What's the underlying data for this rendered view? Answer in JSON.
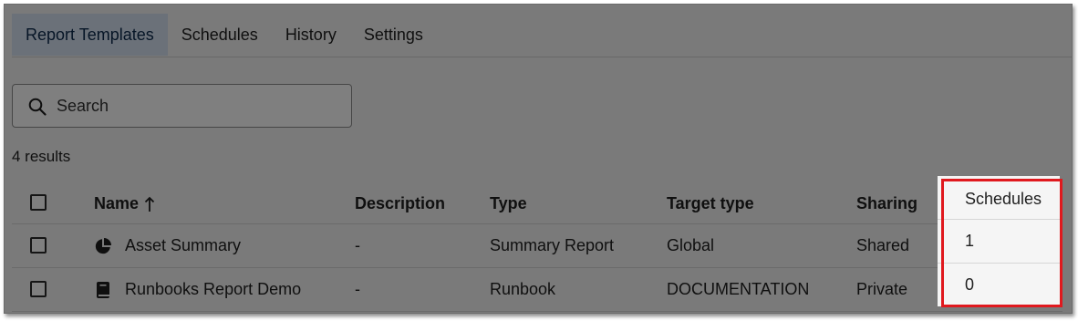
{
  "tabs": [
    {
      "label": "Report Templates",
      "active": true
    },
    {
      "label": "Schedules",
      "active": false
    },
    {
      "label": "History",
      "active": false
    },
    {
      "label": "Settings",
      "active": false
    }
  ],
  "search": {
    "placeholder": "Search",
    "icon": "search-icon"
  },
  "results_count": "4 results",
  "table": {
    "headers": {
      "name": "Name",
      "description": "Description",
      "type": "Type",
      "target_type": "Target type",
      "sharing": "Sharing",
      "schedules": "Schedules"
    },
    "sort": {
      "column": "name",
      "direction": "ascending",
      "icon": "arrow-up-icon"
    },
    "rows": [
      {
        "icon": "pie-chart-icon",
        "name": "Asset Summary",
        "description": "-",
        "type": "Summary Report",
        "target_type": "Global",
        "sharing": "Shared",
        "schedules": "1"
      },
      {
        "icon": "book-icon",
        "name": "Runbooks Report Demo",
        "description": "-",
        "type": "Runbook",
        "target_type": "DOCUMENTATION",
        "sharing": "Private",
        "schedules": "0"
      }
    ]
  },
  "colors": {
    "active_tab_bg": "#d6e2f2",
    "highlight_border": "#e0191e",
    "dim_overlay": "rgba(0,0,0,0.5)"
  }
}
